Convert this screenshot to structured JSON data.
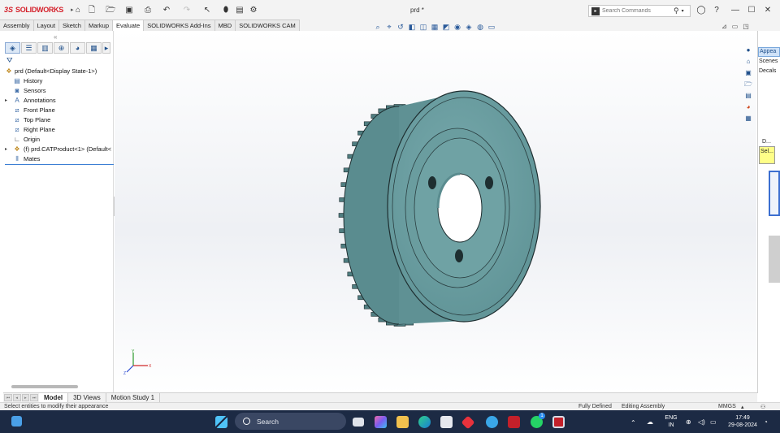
{
  "app": {
    "brand_prefix": "3S",
    "brand": "SOLIDWORKS",
    "document_title": "prd *"
  },
  "search": {
    "placeholder": "Search Commands"
  },
  "command_tabs": [
    {
      "label": "Assembly",
      "active": false
    },
    {
      "label": "Layout",
      "active": false
    },
    {
      "label": "Sketch",
      "active": false
    },
    {
      "label": "Markup",
      "active": false
    },
    {
      "label": "Evaluate",
      "active": true
    },
    {
      "label": "SOLIDWORKS Add-Ins",
      "active": false
    },
    {
      "label": "MBD",
      "active": false
    },
    {
      "label": "SOLIDWORKS CAM",
      "active": false
    }
  ],
  "feature_tree": {
    "root": {
      "label": "prd  (Default<Display State-1>)",
      "icon": "assembly-icon"
    },
    "items": [
      {
        "label": "History",
        "icon": "history-icon",
        "expandable": false
      },
      {
        "label": "Sensors",
        "icon": "sensors-icon",
        "expandable": false
      },
      {
        "label": "Annotations",
        "icon": "annotations-icon",
        "expandable": true
      },
      {
        "label": "Front Plane",
        "icon": "plane-icon",
        "expandable": false
      },
      {
        "label": "Top Plane",
        "icon": "plane-icon",
        "expandable": false
      },
      {
        "label": "Right Plane",
        "icon": "plane-icon",
        "expandable": false
      },
      {
        "label": "Origin",
        "icon": "origin-icon",
        "expandable": false
      },
      {
        "label": "(f) prd.CATProduct<1> (Default<",
        "icon": "component-icon",
        "expandable": true
      },
      {
        "label": "Mates",
        "icon": "mates-icon",
        "expandable": false
      }
    ]
  },
  "task_pane": {
    "appearances_label": "Appea",
    "scenes_label": "Scenes",
    "decals_label": "Decals",
    "d_label": "D...",
    "sel_label": "Sel..."
  },
  "bottom_tabs": [
    {
      "label": "Model",
      "active": true
    },
    {
      "label": "3D Views",
      "active": false
    },
    {
      "label": "Motion Study 1",
      "active": false
    }
  ],
  "status_bar": {
    "message": "Select entities to modify their appearance",
    "definition": "Fully Defined",
    "mode": "Editing Assembly",
    "units": "MMGS"
  },
  "taskbar": {
    "search_label": "Search",
    "language_line1": "ENG",
    "language_line2": "IN",
    "time": "17:49",
    "date": "29-08-2024",
    "whatsapp_badge": "1"
  },
  "colors": {
    "part_fill": "#6b9ea1",
    "part_dark": "#4f7d80",
    "accent": "#d4202a",
    "taskbar": "#1c2a44"
  }
}
